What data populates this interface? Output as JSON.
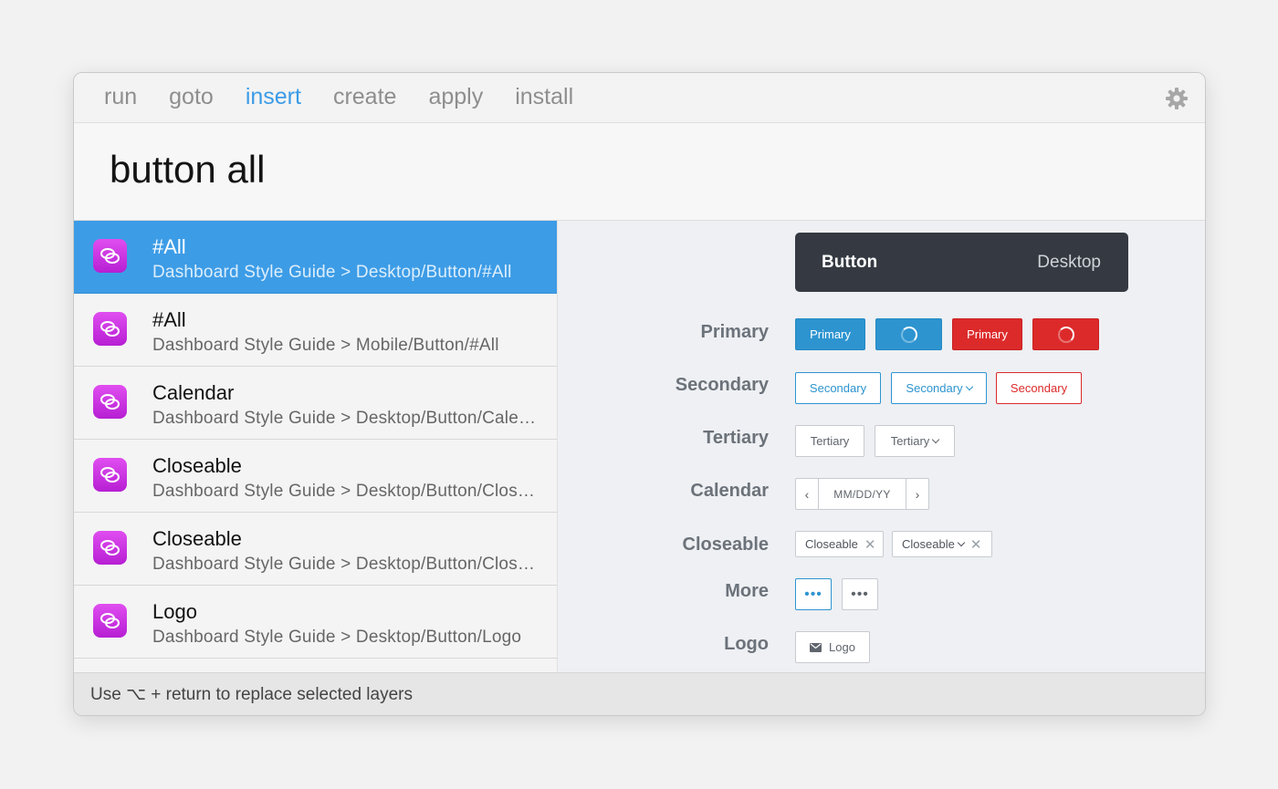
{
  "tabs": [
    "run",
    "goto",
    "insert",
    "create",
    "apply",
    "install"
  ],
  "active_tab": "insert",
  "search": {
    "query": "button all"
  },
  "results": [
    {
      "title": "#All",
      "subtitle": "Dashboard Style Guide > Desktop/Button/#All"
    },
    {
      "title": "#All",
      "subtitle": "Dashboard Style Guide > Mobile/Button/#All"
    },
    {
      "title": "Calendar",
      "subtitle": "Dashboard Style Guide > Desktop/Button/Calendar"
    },
    {
      "title": "Closeable",
      "subtitle": "Dashboard Style Guide > Desktop/Button/Closeable"
    },
    {
      "title": "Closeable",
      "subtitle": "Dashboard Style Guide > Desktop/Button/Closeable"
    },
    {
      "title": "Logo",
      "subtitle": "Dashboard Style Guide > Desktop/Button/Logo"
    }
  ],
  "preview": {
    "header_title": "Button",
    "header_platform": "Desktop",
    "labels": {
      "primary": "Primary",
      "secondary": "Secondary",
      "tertiary": "Tertiary",
      "calendar": "Calendar",
      "closeable": "Closeable",
      "more": "More",
      "logo": "Logo"
    },
    "buttons": {
      "primary": "Primary",
      "secondary": "Secondary",
      "tertiary": "Tertiary",
      "calendar_placeholder": "MM/DD/YY",
      "closeable": "Closeable",
      "logo": "Logo"
    }
  },
  "footer": {
    "hint": "Use ⌥ + return to replace selected layers"
  },
  "colors": {
    "accent": "#3b9be6",
    "primary_blue": "#2d94d0",
    "danger_red": "#dc2a2a",
    "icon_magenta": "#c62fe0"
  }
}
